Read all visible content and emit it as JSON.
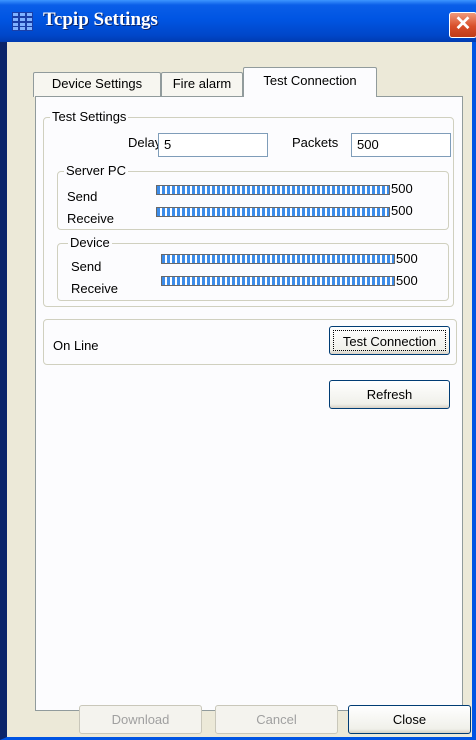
{
  "window": {
    "title": "Tcpip Settings",
    "close_label": "✕"
  },
  "tabs": [
    {
      "label": "Device Settings"
    },
    {
      "label": "Fire alarm"
    },
    {
      "label": "Test Connection"
    }
  ],
  "test_settings": {
    "group_label": "Test Settings",
    "delay_label": "Delay",
    "delay_value": "5",
    "packets_label": "Packets",
    "packets_value": "500"
  },
  "server_pc": {
    "group_label": "Server PC",
    "send_label": "Send",
    "send_value": "500",
    "send_progress": 1.0,
    "receive_label": "Receive",
    "receive_value": "500",
    "receive_progress": 1.0
  },
  "device": {
    "group_label": "Device",
    "send_label": "Send",
    "send_value": "500",
    "send_progress": 1.0,
    "receive_label": "Receive",
    "receive_value": "500",
    "receive_progress": 1.0
  },
  "status": {
    "text": "On Line",
    "test_button_label": "Test Connection"
  },
  "refresh_button_label": "Refresh",
  "footer": {
    "download_label": "Download",
    "cancel_label": "Cancel",
    "close_label": "Close"
  },
  "colors": {
    "titlebar": "#0055E3",
    "progress": "#3C8CE9",
    "face": "#ECE9D8"
  }
}
